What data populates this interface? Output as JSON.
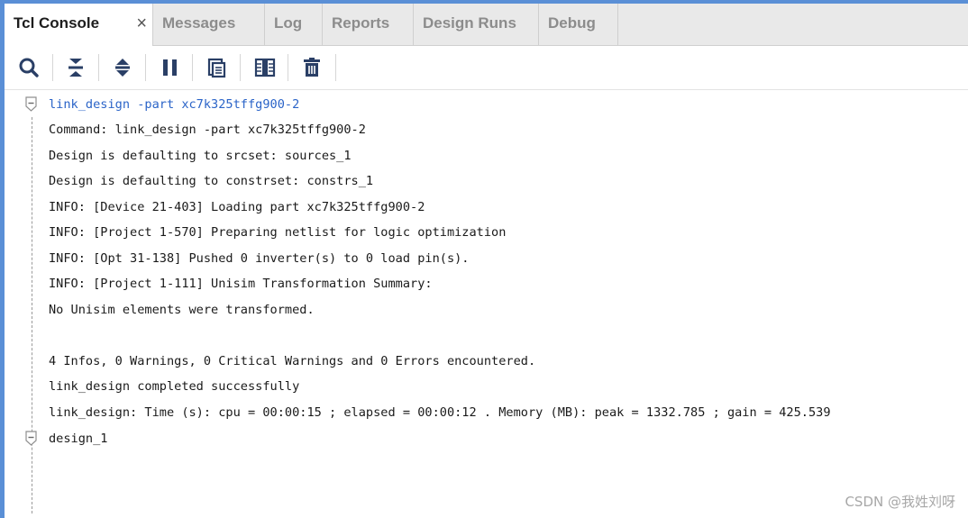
{
  "tabs": {
    "tcl_console": "Tcl Console",
    "close_glyph": "×",
    "messages": "Messages",
    "log": "Log",
    "reports": "Reports",
    "design_runs": "Design Runs",
    "debug": "Debug"
  },
  "toolbar_icons": [
    "search-icon",
    "collapse-all-icon",
    "expand-all-icon",
    "pause-icon",
    "copy-icon",
    "columns-icon",
    "delete-icon"
  ],
  "console": {
    "command": "link_design -part xc7k325tffg900-2",
    "lines": [
      "Command: link_design -part xc7k325tffg900-2",
      "Design is defaulting to srcset: sources_1",
      "Design is defaulting to constrset: constrs_1",
      "INFO: [Device 21-403] Loading part xc7k325tffg900-2",
      "INFO: [Project 1-570] Preparing netlist for logic optimization",
      "INFO: [Opt 31-138] Pushed 0 inverter(s) to 0 load pin(s).",
      "INFO: [Project 1-111] Unisim Transformation Summary:",
      "No Unisim elements were transformed.",
      "",
      "4 Infos, 0 Warnings, 0 Critical Warnings and 0 Errors encountered.",
      "link_design completed successfully",
      "link_design: Time (s): cpu = 00:00:15 ; elapsed = 00:00:12 . Memory (MB): peak = 1332.785 ; gain = 425.539"
    ],
    "result": "design_1"
  },
  "watermark": "CSDN @我姓刘呀",
  "colors": {
    "accent": "#5a8fd6",
    "command_text": "#2b64c8",
    "icon": "#2a3f66"
  }
}
